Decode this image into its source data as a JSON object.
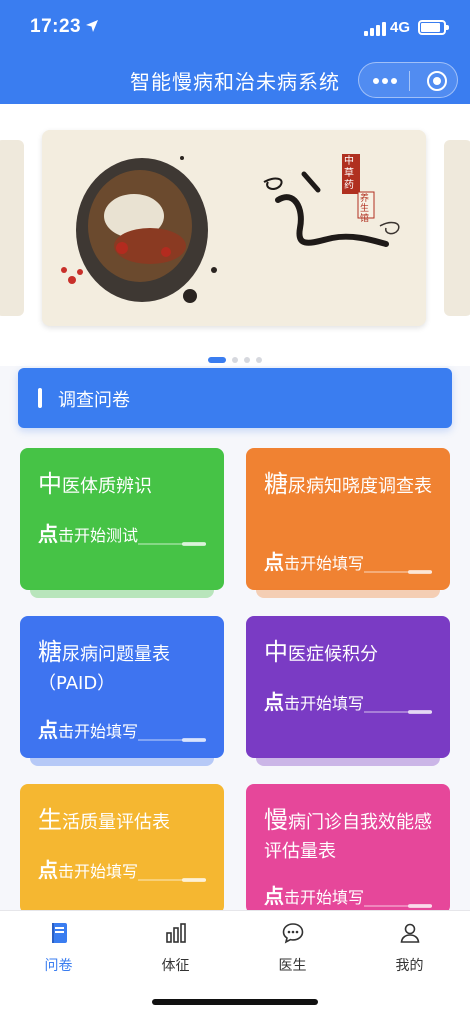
{
  "status_bar": {
    "time": "17:23",
    "network": "4G"
  },
  "nav": {
    "title": "智能慢病和治未病系统"
  },
  "carousel": {
    "slide_text": {
      "seal": "中草药",
      "sub": "养生馆",
      "calligraphy": "道"
    },
    "total_slides": 4,
    "active_index": 0
  },
  "section": {
    "label": "调查问卷"
  },
  "cards": [
    {
      "title_first": "中",
      "title_rest": "医体质辨识",
      "action_first": "点",
      "action_rest": "击开始测试",
      "color": "#46c346"
    },
    {
      "title_first": "糖",
      "title_rest": "尿病知晓度调查表",
      "action_first": "点",
      "action_rest": "击开始填写",
      "color": "#f08232"
    },
    {
      "title_first": "糖",
      "title_rest": "尿病问题量表（PAID）",
      "action_first": "点",
      "action_rest": "击开始填写",
      "color": "#3e74f0"
    },
    {
      "title_first": "中",
      "title_rest": "医症候积分",
      "action_first": "点",
      "action_rest": "击开始填写",
      "color": "#7a3bc4"
    },
    {
      "title_first": "生",
      "title_rest": "活质量评估表",
      "action_first": "点",
      "action_rest": "击开始填写",
      "color": "#f5b731"
    },
    {
      "title_first": "慢",
      "title_rest": "病门诊自我效能感评估量表",
      "action_first": "点",
      "action_rest": "击开始填写",
      "color": "#e6479a"
    }
  ],
  "tabs": [
    {
      "label": "问卷",
      "icon": "questionnaire-icon",
      "active": true
    },
    {
      "label": "体征",
      "icon": "bar-chart-icon",
      "active": false
    },
    {
      "label": "医生",
      "icon": "chat-icon",
      "active": false
    },
    {
      "label": "我的",
      "icon": "user-icon",
      "active": false
    }
  ],
  "colors": {
    "primary": "#3a7df0"
  }
}
